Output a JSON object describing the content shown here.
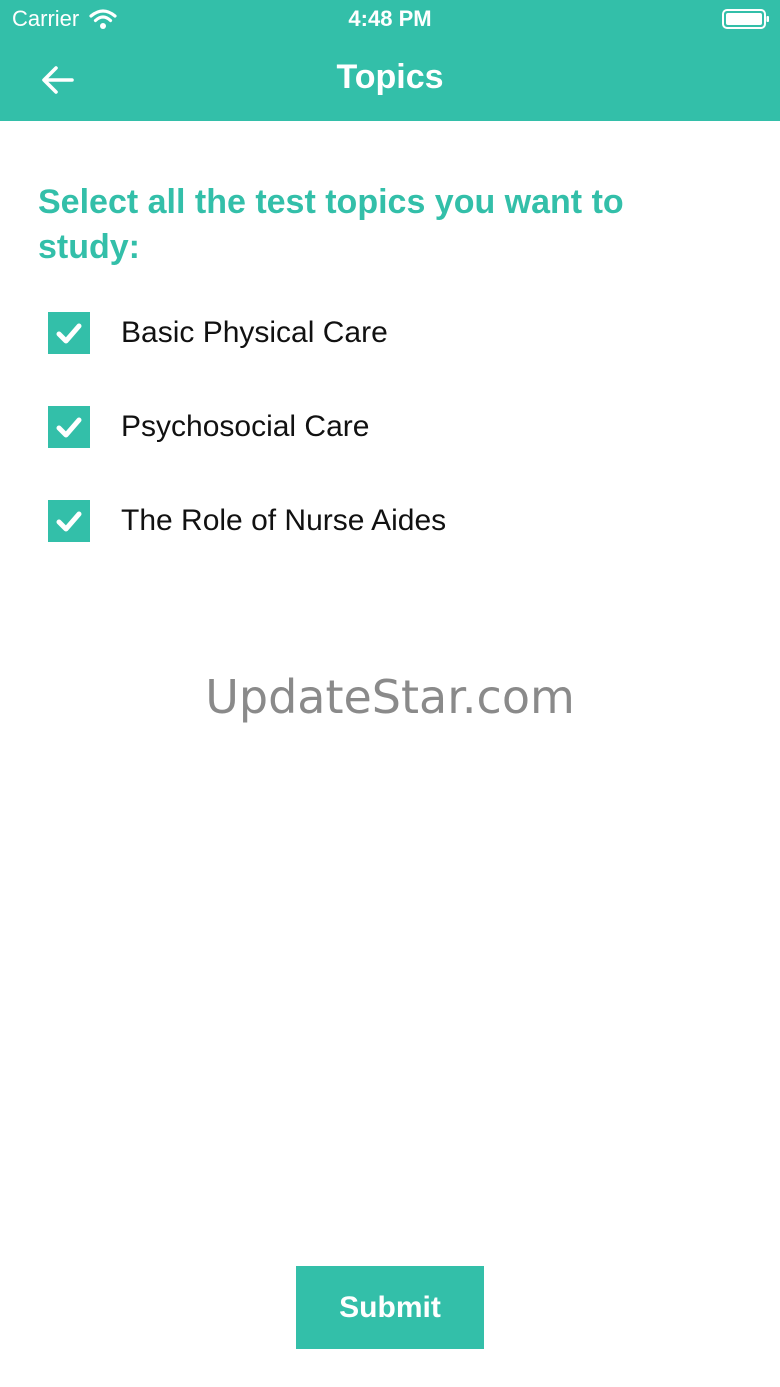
{
  "status_bar": {
    "carrier": "Carrier",
    "time": "4:48 PM",
    "wifi_icon": "wifi-icon",
    "battery_icon": "battery-icon"
  },
  "nav": {
    "title": "Topics",
    "back_icon": "arrow-left-icon"
  },
  "prompt": "Select all the test topics you want to study:",
  "topics": [
    {
      "label": "Basic Physical Care",
      "checked": true
    },
    {
      "label": "Psychosocial Care",
      "checked": true
    },
    {
      "label": "The Role of Nurse Aides",
      "checked": true
    }
  ],
  "watermark": "UpdateStar.com",
  "submit_label": "Submit",
  "colors": {
    "accent": "#33bfa9",
    "text": "#111111",
    "watermark": "#8a8a8a"
  }
}
